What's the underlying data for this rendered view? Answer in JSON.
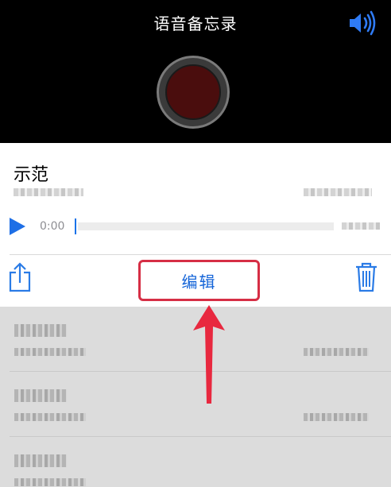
{
  "header": {
    "title": "语音备忘录"
  },
  "current_recording": {
    "name": "示范",
    "playback_start_time": "0:00",
    "edit_label": "编辑"
  },
  "icons": {
    "speaker": "speaker-icon",
    "record": "record-button-icon",
    "play": "play-icon",
    "share": "share-icon",
    "trash": "trash-icon"
  },
  "colors": {
    "accent_blue": "#1565d8",
    "highlight_red": "#d62e45",
    "record_dark_red": "#4a0d0d"
  }
}
